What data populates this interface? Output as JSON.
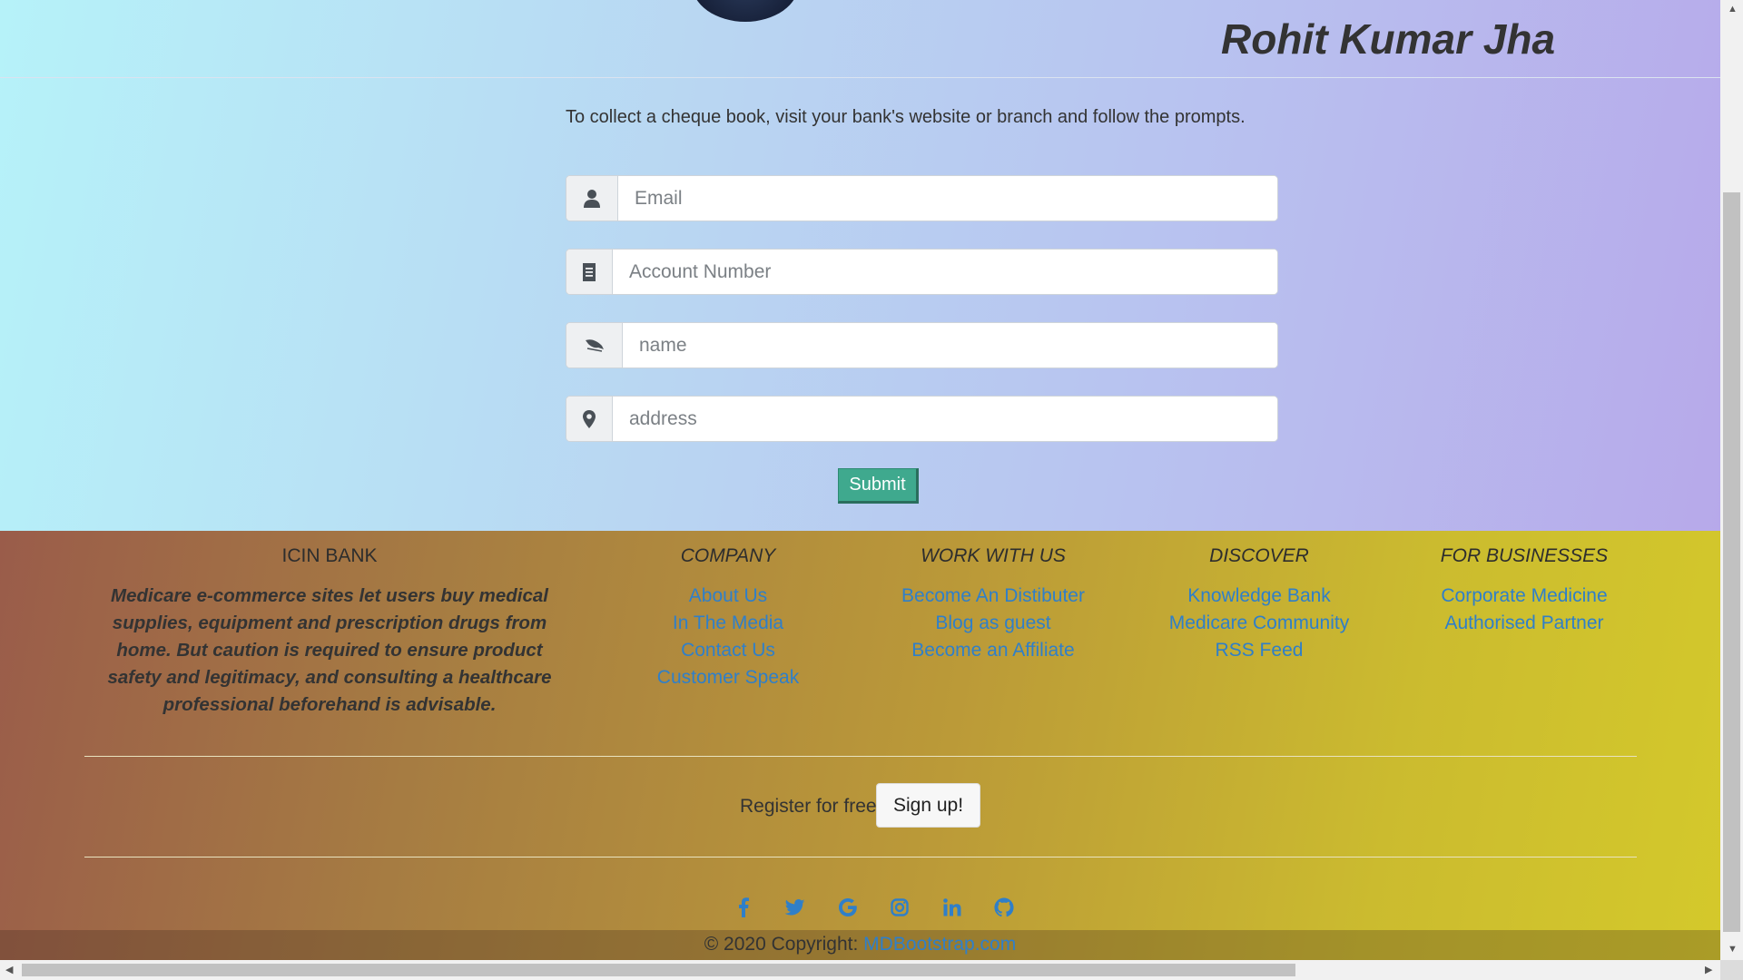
{
  "header": {
    "user_name": "Rohit Kumar Jha"
  },
  "form": {
    "intro": "To collect a cheque book, visit your bank's website or branch and follow the prompts.",
    "email_placeholder": "Email",
    "account_placeholder": "Account Number",
    "name_placeholder": "name",
    "address_placeholder": "address",
    "submit_label": "Submit"
  },
  "footer": {
    "about": {
      "title": "ICIN BANK",
      "text": "Medicare e-commerce sites let users buy medical supplies, equipment and prescription drugs from home. But caution is required to ensure product safety and legitimacy, and consulting a healthcare professional beforehand is advisable."
    },
    "columns": [
      {
        "title": "COMPANY",
        "links": [
          "About Us",
          "In The Media",
          "Contact Us",
          "Customer Speak"
        ]
      },
      {
        "title": "WORK WITH US",
        "links": [
          "Become An Distibuter",
          "Blog as guest",
          "Become an Affiliate"
        ]
      },
      {
        "title": "DISCOVER",
        "links": [
          "Knowledge Bank",
          "Medicare Community",
          "RSS Feed"
        ]
      },
      {
        "title": "FOR BUSINESSES",
        "links": [
          "Corporate Medicine",
          "Authorised Partner"
        ]
      }
    ],
    "register_text": "Register for free",
    "signup_label": "Sign up!",
    "social_icons": [
      "facebook-icon",
      "twitter-icon",
      "google-icon",
      "instagram-icon",
      "linkedin-icon",
      "github-icon"
    ],
    "copyright_text": "© 2020 Copyright:",
    "copyright_link": "MDBootstrap.com"
  },
  "colors": {
    "link": "#2f7fc9",
    "submit": "#3fa98e"
  }
}
